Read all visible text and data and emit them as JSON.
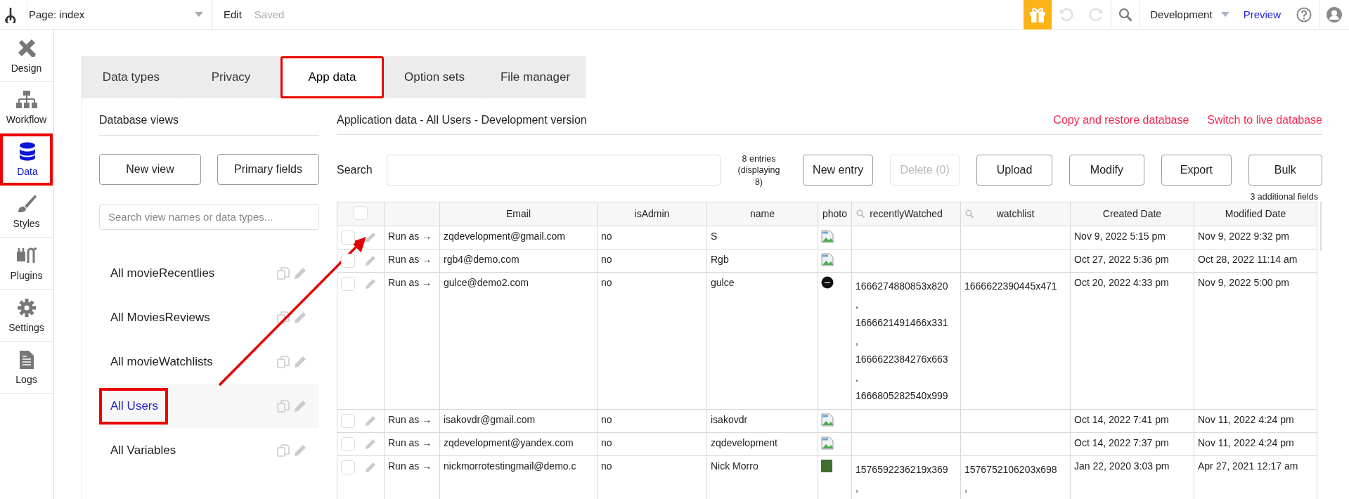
{
  "top_bar": {
    "page_selector": "Page: index",
    "edit": "Edit",
    "saved": "Saved",
    "environment": "Development",
    "preview": "Preview"
  },
  "sidebar": {
    "items": [
      {
        "label": "Design",
        "kind": "design",
        "selected": false,
        "annotated": false
      },
      {
        "label": "Workflow",
        "kind": "workflow",
        "selected": false,
        "annotated": false
      },
      {
        "label": "Data",
        "kind": "data",
        "selected": true,
        "annotated": true
      },
      {
        "label": "Styles",
        "kind": "styles",
        "selected": false,
        "annotated": false
      },
      {
        "label": "Plugins",
        "kind": "plugins",
        "selected": false,
        "annotated": false
      },
      {
        "label": "Settings",
        "kind": "settings",
        "selected": false,
        "annotated": false
      },
      {
        "label": "Logs",
        "kind": "logs",
        "selected": false,
        "annotated": false
      }
    ]
  },
  "tabs": [
    {
      "label": "Data types",
      "selected": false,
      "annotated": false
    },
    {
      "label": "Privacy",
      "selected": false,
      "annotated": false
    },
    {
      "label": "App data",
      "selected": true,
      "annotated": true
    },
    {
      "label": "Option sets",
      "selected": false,
      "annotated": false
    },
    {
      "label": "File manager",
      "selected": false,
      "annotated": false
    }
  ],
  "database_views": {
    "title": "Database views",
    "buttons": [
      "New view",
      "Primary fields"
    ],
    "search": {
      "placeholder": "Search view names or data types..."
    },
    "items": [
      {
        "label": "All movieRecentlies",
        "selected": false,
        "annotated": false
      },
      {
        "label": "All MoviesReviews",
        "selected": false,
        "annotated": false
      },
      {
        "label": "All movieWatchlists",
        "selected": false,
        "annotated": false
      },
      {
        "label": "All Users",
        "selected": true,
        "annotated": true
      },
      {
        "label": "All Variables",
        "selected": false,
        "annotated": false
      }
    ]
  },
  "app_data": {
    "title": "Application data - All Users - Development version",
    "links": [
      "Copy and restore database",
      "Switch to live database"
    ],
    "search_label": "Search",
    "entries_info": "8 entries\n(displaying 8)",
    "buttons": [
      {
        "label": "New entry",
        "disabled": false
      },
      {
        "label": "Delete (0)",
        "disabled": true
      },
      {
        "label": "Upload",
        "disabled": false
      },
      {
        "label": "Modify",
        "disabled": false
      },
      {
        "label": "Export",
        "disabled": false
      },
      {
        "label": "Bulk",
        "disabled": false
      }
    ],
    "additional_fields": "3 additional fields",
    "table": {
      "select_all_checked": false,
      "columns": [
        {
          "label": "Email",
          "searchable": false
        },
        {
          "label": "isAdmin",
          "searchable": false
        },
        {
          "label": "name",
          "searchable": false
        },
        {
          "label": "photo",
          "searchable": false
        },
        {
          "label": "recentlyWatched",
          "searchable": true
        },
        {
          "label": "watchlist",
          "searchable": true
        },
        {
          "label": "Created Date",
          "searchable": false
        },
        {
          "label": "Modified Date",
          "searchable": false
        }
      ],
      "rows": [
        {
          "checked": false,
          "run_as": "Run as →",
          "email": "zqdevelopment@gmail.com",
          "is_admin": "no",
          "name": "S",
          "photo": {
            "kind": "broken"
          },
          "recently_watched": [],
          "watchlist": [],
          "created": "Nov 9, 2022 5:15 pm",
          "modified": "Nov 9, 2022 9:32 pm"
        },
        {
          "checked": false,
          "run_as": "Run as →",
          "email": "rgb4@demo.com",
          "is_admin": "no",
          "name": "Rgb",
          "photo": {
            "kind": "broken"
          },
          "recently_watched": [],
          "watchlist": [],
          "created": "Oct 27, 2022 5:36 pm",
          "modified": "Oct 28, 2022 11:14 am"
        },
        {
          "checked": false,
          "run_as": "Run as →",
          "email": "gulce@demo2.com",
          "is_admin": "no",
          "name": "gulce",
          "photo": {
            "kind": "logo"
          },
          "recently_watched": [
            "1666274880853x820",
            ",",
            "1666621491466x331",
            ",",
            "1666622384276x663",
            ",",
            "1666805282540x999"
          ],
          "watchlist": [
            "1666622390445x471"
          ],
          "created": "Oct 20, 2022 4:33 pm",
          "modified": "Nov 9, 2022 5:00 pm"
        },
        {
          "checked": false,
          "run_as": "Run as →",
          "email": "isakovdr@gmail.com",
          "is_admin": "no",
          "name": "isakovdr",
          "photo": {
            "kind": "broken"
          },
          "recently_watched": [],
          "watchlist": [],
          "created": "Oct 14, 2022 7:41 pm",
          "modified": "Nov 11, 2022 4:24 pm"
        },
        {
          "checked": false,
          "run_as": "Run as →",
          "email": "zqdevelopment@yandex.com",
          "is_admin": "no",
          "name": "zqdevelopment",
          "photo": {
            "kind": "broken"
          },
          "recently_watched": [],
          "watchlist": [],
          "created": "Oct 14, 2022 7:37 pm",
          "modified": "Nov 11, 2022 4:24 pm"
        },
        {
          "checked": false,
          "run_as": "Run as →",
          "email": "nickmorrotestingmail@demo.c",
          "is_admin": "no",
          "name": "Nick Morro",
          "photo": {
            "kind": "photo"
          },
          "recently_watched": [
            "1576592236219x369",
            ","
          ],
          "watchlist": [
            "1576752106203x698",
            ","
          ],
          "created": "Jan 22, 2020 3:03 pm",
          "modified": "Apr 27, 2021 12:17 am"
        }
      ]
    }
  }
}
